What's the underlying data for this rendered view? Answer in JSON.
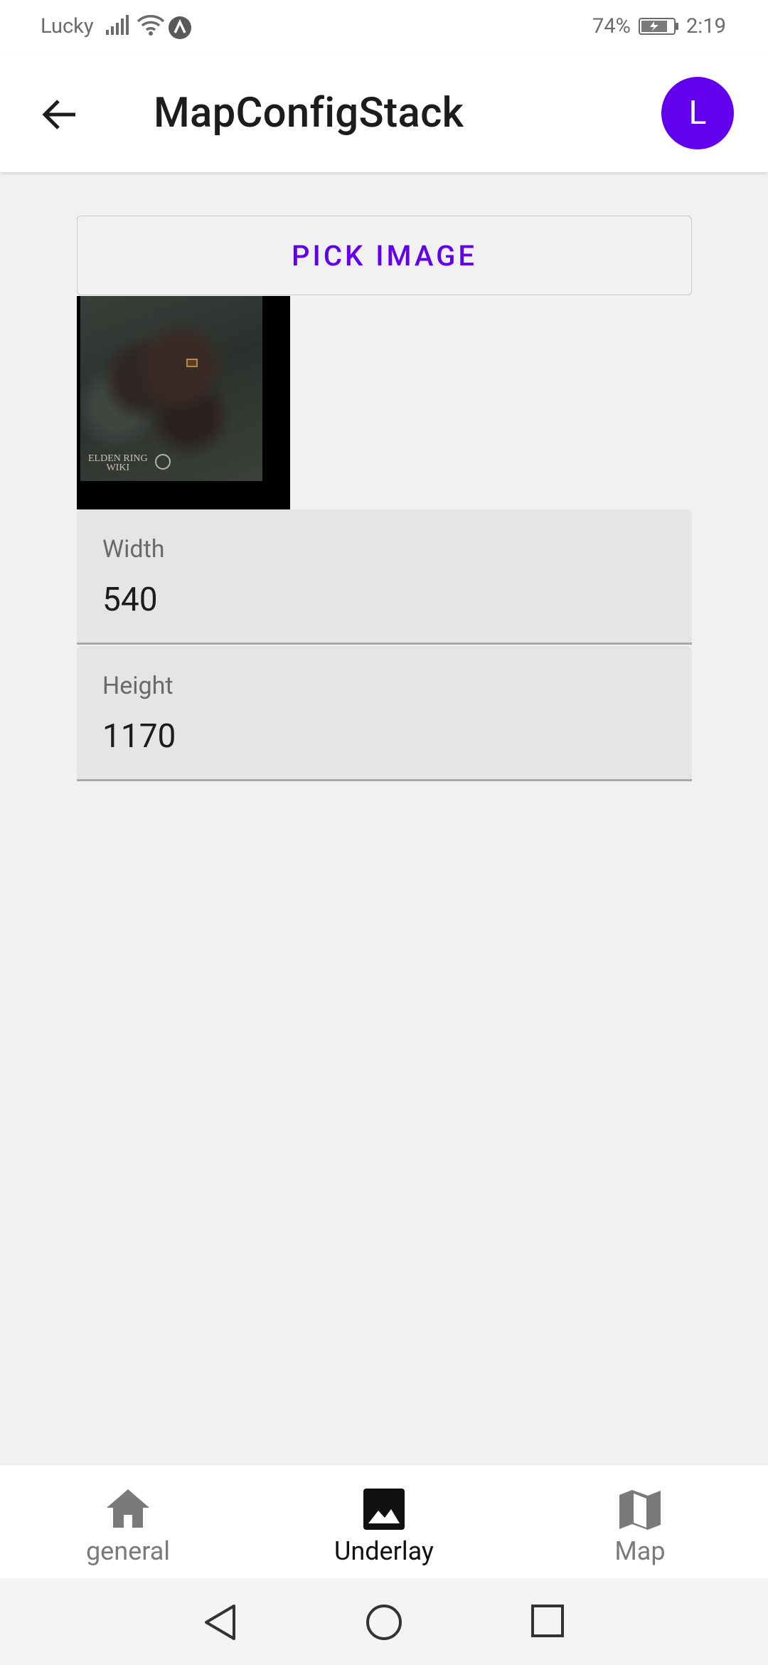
{
  "status_bar": {
    "carrier": "Lucky",
    "battery_percent": "74%",
    "time": "2:19"
  },
  "app_bar": {
    "title": "MapConfigStack",
    "avatar_initial": "L"
  },
  "content": {
    "pick_image_label": "PICK IMAGE",
    "preview_logo_line1": "ELDEN RING",
    "preview_logo_line2": "WIKI",
    "width_field": {
      "label": "Width",
      "value": "540"
    },
    "height_field": {
      "label": "Height",
      "value": "1170"
    }
  },
  "bottom_nav": {
    "items": [
      {
        "label": "general",
        "icon": "home-icon",
        "active": false
      },
      {
        "label": "Underlay",
        "icon": "image-icon",
        "active": true
      },
      {
        "label": "Map",
        "icon": "map-icon",
        "active": false
      }
    ]
  },
  "colors": {
    "accent": "#6200ee",
    "background": "#f1f1f1",
    "field_background": "#e5e5e5"
  }
}
